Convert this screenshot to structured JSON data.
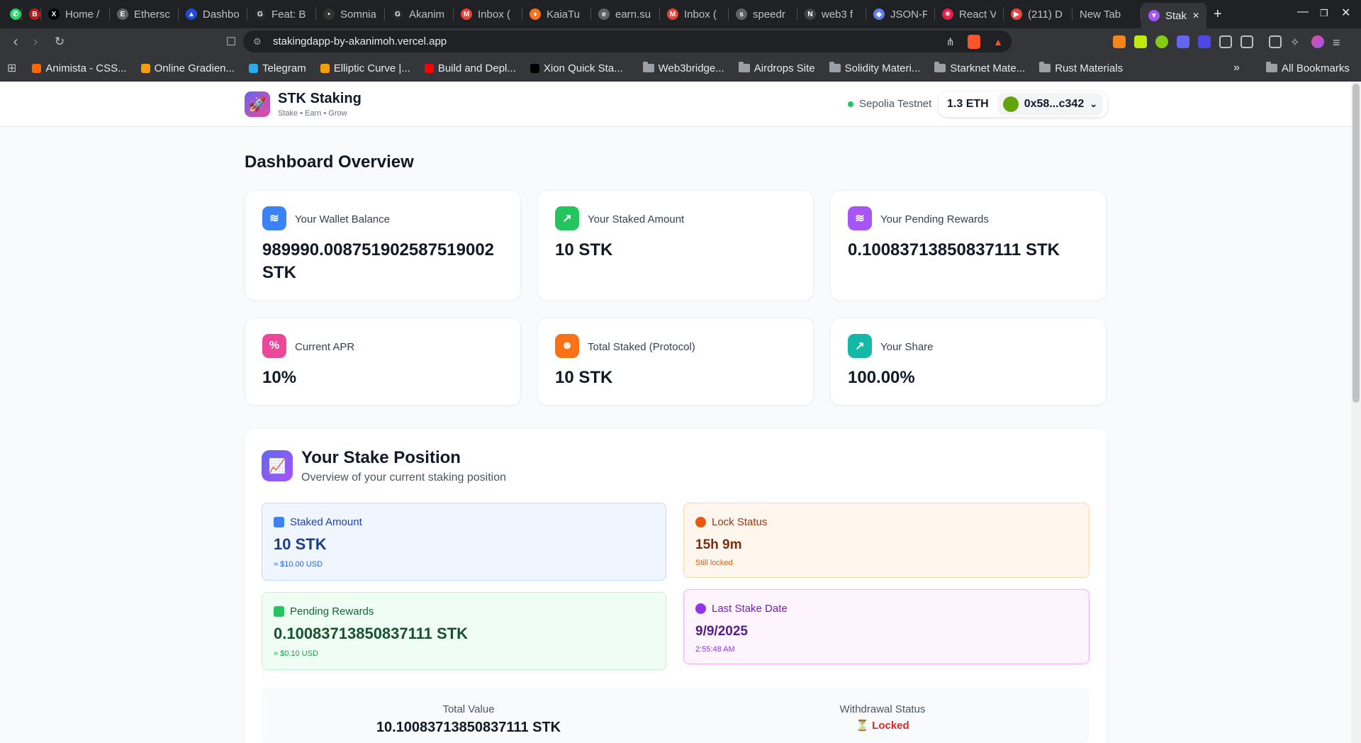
{
  "browser": {
    "tabs": [
      {
        "label": "",
        "color": "#25d366",
        "glyph": "✆"
      },
      {
        "label": "",
        "color": "#b91c1c",
        "glyph": "B"
      },
      {
        "label": "Home /",
        "color": "#000000",
        "glyph": "X"
      },
      {
        "label": "Ethersc",
        "color": "#5f6368",
        "glyph": "E"
      },
      {
        "label": "Dashbo",
        "color": "#1d4ed8",
        "glyph": "▲"
      },
      {
        "label": "Feat: B",
        "color": "#24292e",
        "glyph": "G"
      },
      {
        "label": "Somnia",
        "color": "#333333",
        "glyph": "•"
      },
      {
        "label": "Akanim",
        "color": "#24292e",
        "glyph": "G"
      },
      {
        "label": "Inbox (",
        "color": "#ea4335",
        "glyph": "M"
      },
      {
        "label": "KaiaTu",
        "color": "#f97316",
        "glyph": "♦"
      },
      {
        "label": "earn.su",
        "color": "#5f6368",
        "glyph": "e"
      },
      {
        "label": "Inbox (",
        "color": "#ea4335",
        "glyph": "M"
      },
      {
        "label": "speedr",
        "color": "#5f6368",
        "glyph": "s"
      },
      {
        "label": "web3 f",
        "color": "#444444",
        "glyph": "N"
      },
      {
        "label": "JSON-F",
        "color": "#627eea",
        "glyph": "◆"
      },
      {
        "label": "React V",
        "color": "#e11d48",
        "glyph": "✳"
      },
      {
        "label": "(211) D",
        "color": "#ef4444",
        "glyph": "▶"
      },
      {
        "label": "New Tab",
        "color": "",
        "glyph": ""
      },
      {
        "label": "Stak",
        "color": "#a855f7",
        "glyph": "▼",
        "active": true
      }
    ],
    "url": "stakingdapp-by-akanimoh.vercel.app",
    "bookmarks": [
      {
        "label": "Animista - CSS...",
        "type": "site",
        "color": "#ff6600"
      },
      {
        "label": "Online Gradien...",
        "type": "site",
        "color": "#f59e0b"
      },
      {
        "label": "Telegram",
        "type": "site",
        "color": "#2aabee"
      },
      {
        "label": "Elliptic Curve |...",
        "type": "site",
        "color": "#f59e0b"
      },
      {
        "label": "Build and Depl...",
        "type": "site",
        "color": "#ff0000"
      },
      {
        "label": "Xion Quick Sta...",
        "type": "site",
        "color": "#000000"
      },
      {
        "label": "Web3bridge...",
        "type": "folder"
      },
      {
        "label": "Airdrops Site",
        "type": "folder"
      },
      {
        "label": "Solidity Materi...",
        "type": "folder"
      },
      {
        "label": "Starknet Mate...",
        "type": "folder"
      },
      {
        "label": "Rust Materials",
        "type": "folder"
      }
    ],
    "all_bookmarks": "All Bookmarks"
  },
  "header": {
    "brand": "STK Staking",
    "tagline": "Stake • Earn • Grow",
    "network": "Sepolia Testnet",
    "eth_balance": "1.3 ETH",
    "address": "0x58...c342"
  },
  "dashboard": {
    "title": "Dashboard Overview",
    "cards": [
      {
        "label": "Your Wallet Balance",
        "value": "989990.008751902587519002 STK",
        "icon": "coins-icon",
        "color": "#3b82f6"
      },
      {
        "label": "Your Staked Amount",
        "value": "10 STK",
        "icon": "chart-up-icon",
        "color": "#22c55e"
      },
      {
        "label": "Your Pending Rewards",
        "value": "0.10083713850837111 STK",
        "icon": "coins-icon",
        "color": "#a855f7"
      },
      {
        "label": "Current APR",
        "value": "10%",
        "icon": "percent-icon",
        "color": "#ec4899"
      },
      {
        "label": "Total Staked (Protocol)",
        "value": "10 STK",
        "icon": "users-icon",
        "color": "#f97316"
      },
      {
        "label": "Your Share",
        "value": "100.00%",
        "icon": "chart-up-icon",
        "color": "#14b8a6"
      }
    ]
  },
  "stake_position": {
    "title": "Your Stake Position",
    "subtitle": "Overview of your current staking position",
    "staked": {
      "label": "Staked Amount",
      "value": "10 STK",
      "usd": "≈ $10.00 USD"
    },
    "lock": {
      "label": "Lock Status",
      "value": "15h 9m",
      "note": "Still locked"
    },
    "rewards": {
      "label": "Pending Rewards",
      "value": "0.10083713850837111 STK",
      "usd": "≈ $0.10 USD"
    },
    "last_stake": {
      "label": "Last Stake Date",
      "date": "9/9/2025",
      "time": "2:55:48 AM"
    },
    "total_value": {
      "label": "Total Value",
      "value": "10.10083713850837111 STK"
    },
    "withdrawal": {
      "label": "Withdrawal Status",
      "value": "⏳ Locked"
    }
  }
}
